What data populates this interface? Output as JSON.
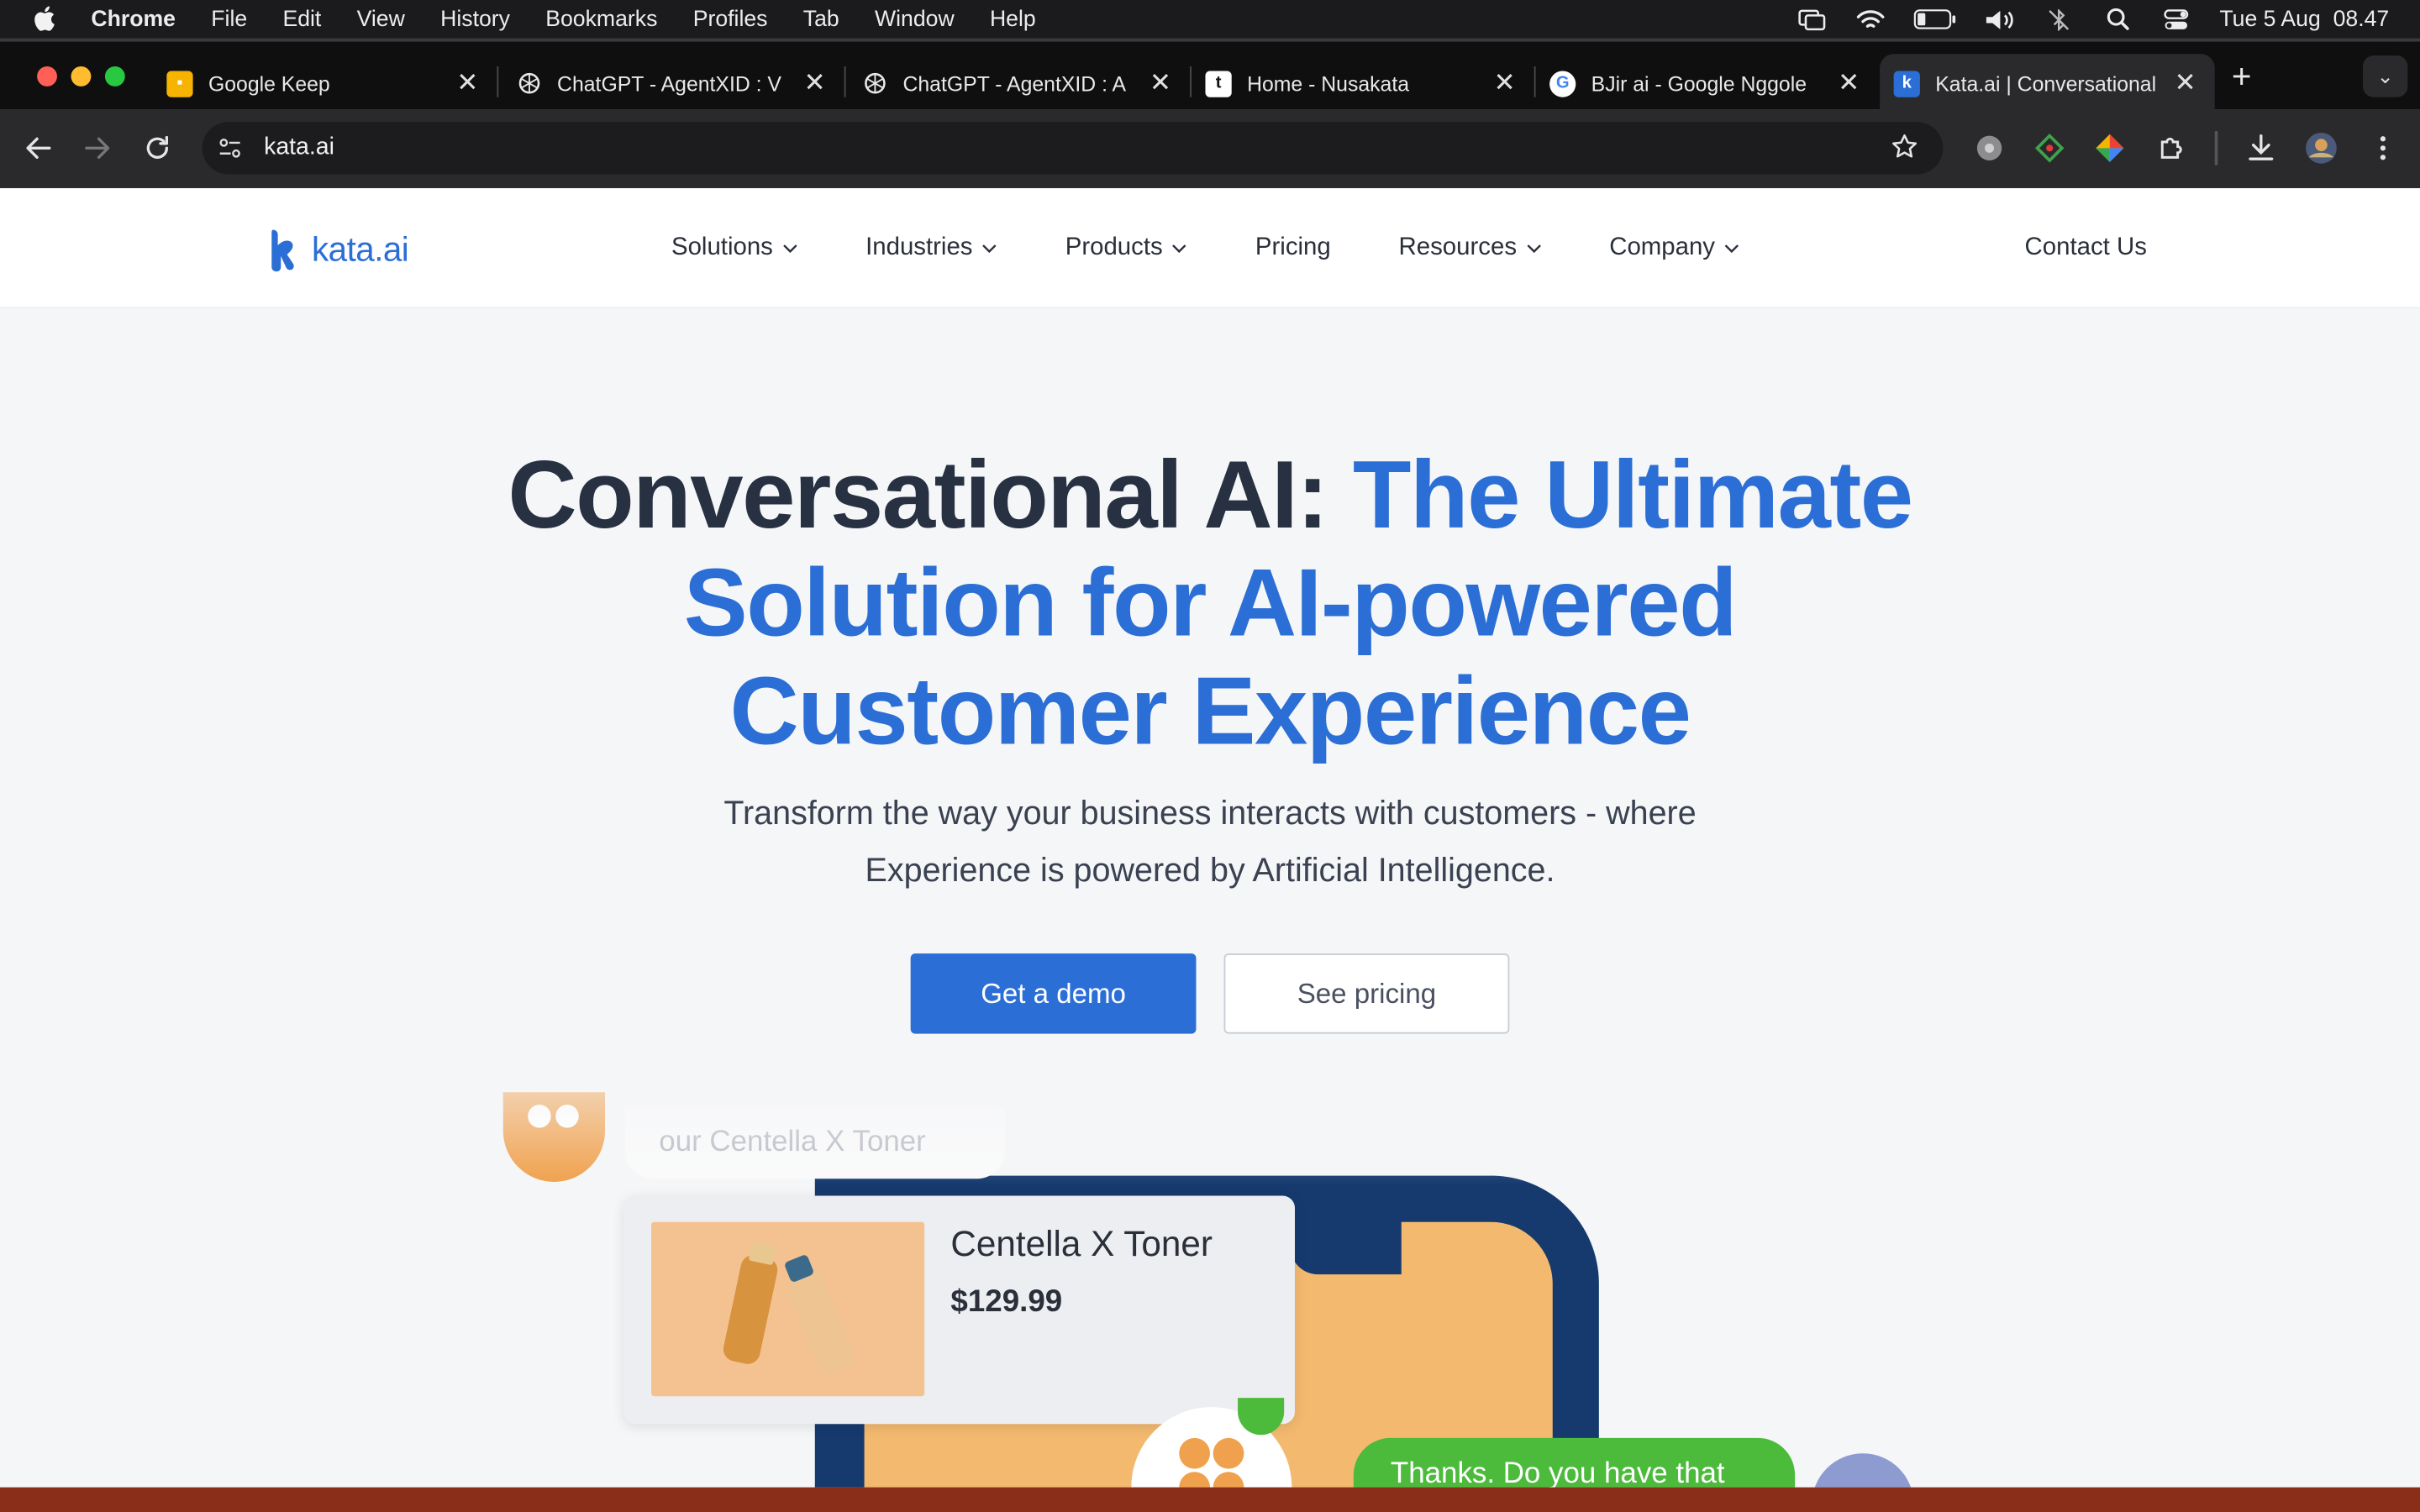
{
  "menubar": {
    "app": "Chrome",
    "menus": [
      "File",
      "Edit",
      "View",
      "History",
      "Bookmarks",
      "Profiles",
      "Tab",
      "Window",
      "Help"
    ],
    "datetime": "Tue 5 Aug  08.47"
  },
  "tabs": [
    {
      "title": "Google Keep",
      "favicon": "keep-icon"
    },
    {
      "title": "ChatGPT - AgentXID : V",
      "favicon": "chatgpt-icon"
    },
    {
      "title": "ChatGPT - AgentXID : A",
      "favicon": "chatgpt-icon"
    },
    {
      "title": "Home - Nusakata",
      "favicon": "nusakata-icon"
    },
    {
      "title": "BJir ai - Google Nggole",
      "favicon": "google-icon"
    },
    {
      "title": "Kata.ai | Conversational",
      "favicon": "kata-icon",
      "active": true
    }
  ],
  "toolbar": {
    "url": "kata.ai"
  },
  "site": {
    "logo": "kata.ai",
    "nav": [
      "Solutions",
      "Industries",
      "Products",
      "Pricing",
      "Resources",
      "Company"
    ],
    "contact": "Contact Us"
  },
  "hero": {
    "title_dark": "Conversational AI: ",
    "title_blue_1": "The Ultimate",
    "title_blue_2": "Solution for AI-powered",
    "title_blue_3": "Customer Experience",
    "subtitle_1": "Transform the way your business interacts with customers - where",
    "subtitle_2": "Experience is powered by Artificial Intelligence.",
    "cta_primary": "Get a demo",
    "cta_secondary": "See pricing"
  },
  "illustration": {
    "top_bubble": "our Centella X Toner",
    "product_name": "Centella X Toner",
    "product_price": "$129.99",
    "reply_bubble": "Thanks. Do you have that"
  },
  "colors": {
    "brand_blue": "#2b6fd6",
    "headline_dark": "#273142",
    "chat_green": "#4cbb3c",
    "phone_navy": "#163a6e"
  }
}
